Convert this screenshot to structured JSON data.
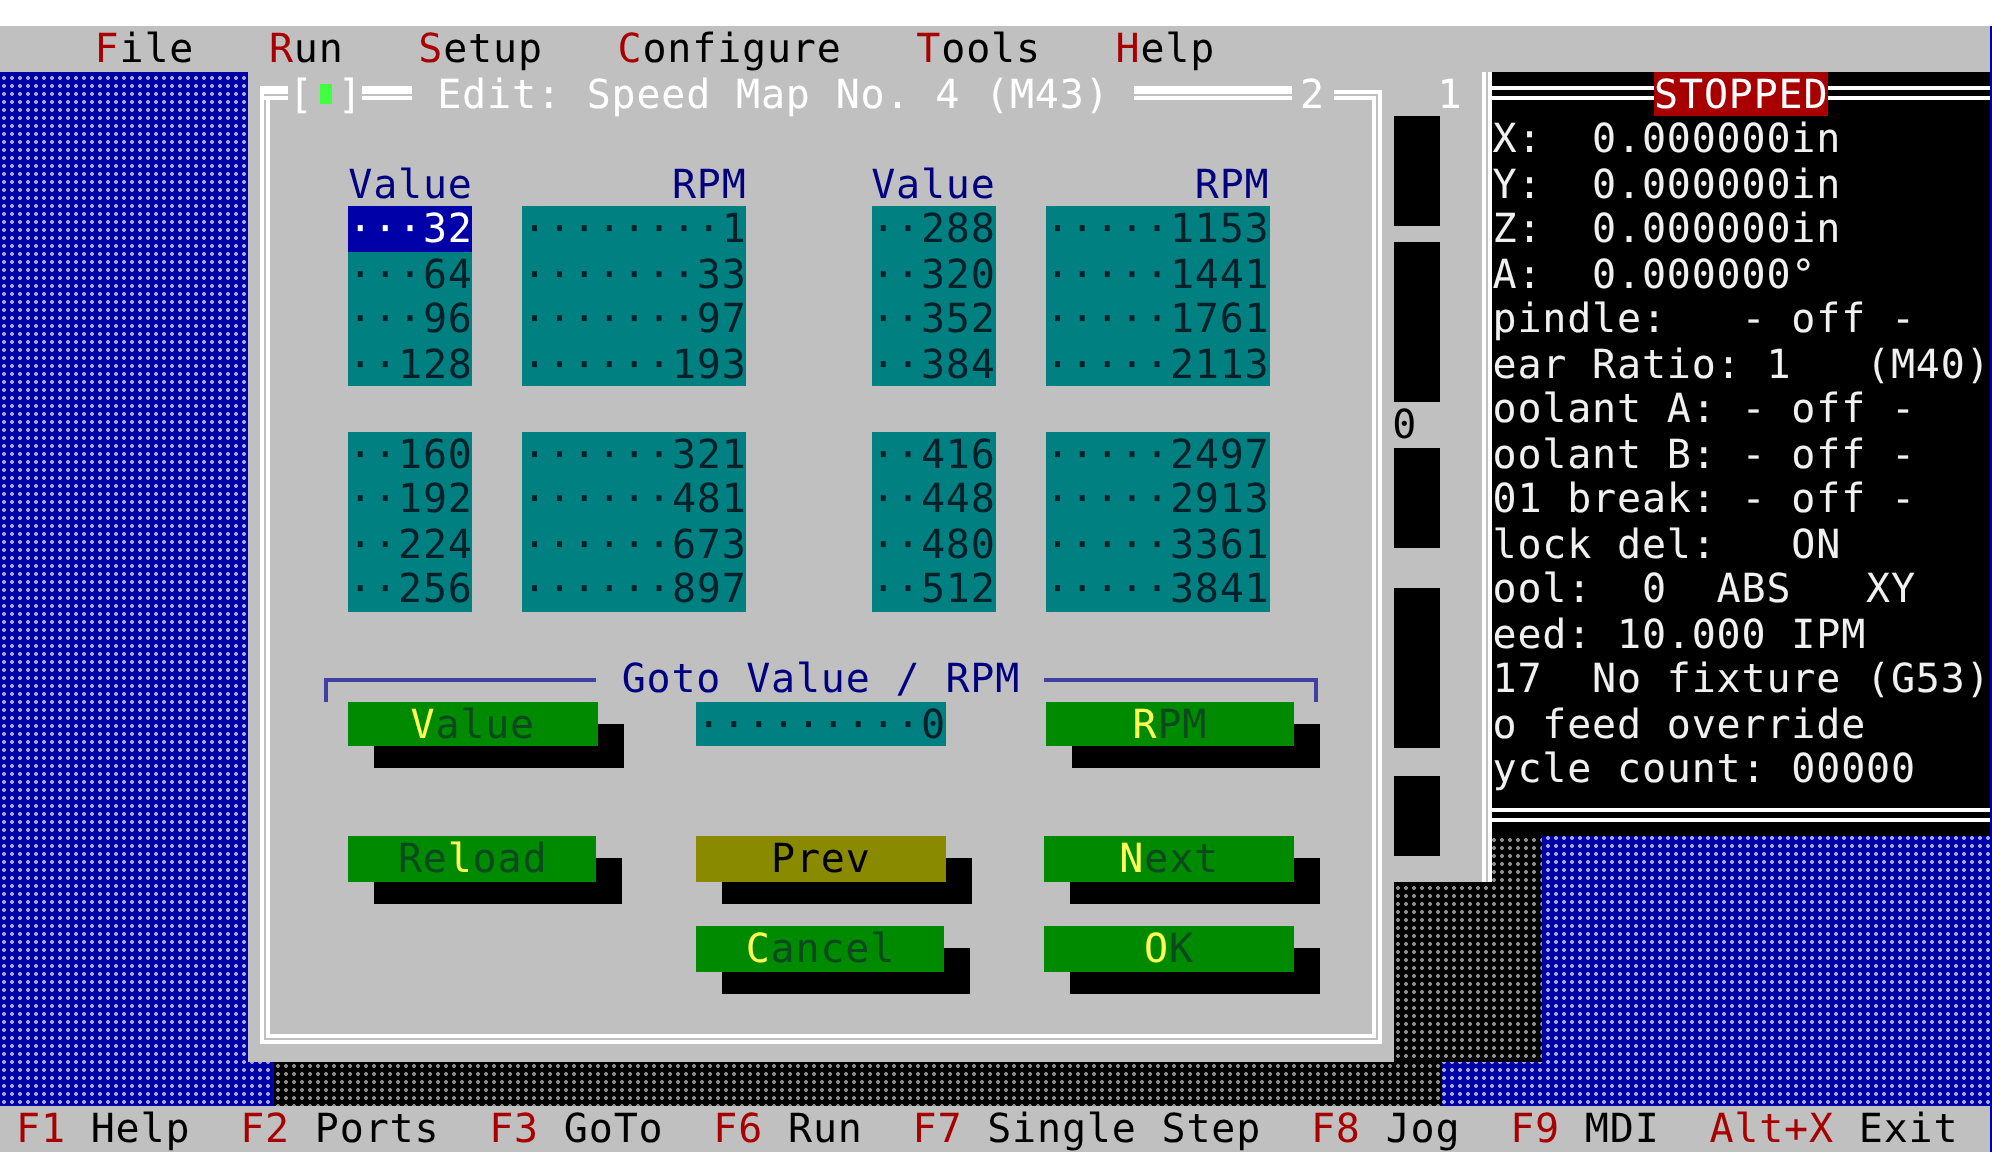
{
  "menu": [
    {
      "key": "F",
      "rest": "ile"
    },
    {
      "key": "R",
      "rest": "un"
    },
    {
      "key": "S",
      "rest": "etup"
    },
    {
      "key": "C",
      "rest": "onfigure"
    },
    {
      "key": "T",
      "rest": "ools"
    },
    {
      "key": "H",
      "rest": "elp"
    }
  ],
  "dialog": {
    "close_button": {
      "left": "[",
      "right": "]"
    },
    "title": "Edit: Speed Map No. 4 (M43)",
    "window_number": "2",
    "map": [
      {
        "value_header": "Value",
        "rpm_header": "RPM",
        "groups": [
          [
            {
              "value": "···32",
              "rpm": "········1",
              "selected": true
            },
            {
              "value": "···64",
              "rpm": "·······33",
              "selected": false
            },
            {
              "value": "···96",
              "rpm": "·······97",
              "selected": false
            },
            {
              "value": "··128",
              "rpm": "······193",
              "selected": false
            }
          ],
          [
            {
              "value": "··160",
              "rpm": "······321",
              "selected": false
            },
            {
              "value": "··192",
              "rpm": "······481",
              "selected": false
            },
            {
              "value": "··224",
              "rpm": "······673",
              "selected": false
            },
            {
              "value": "··256",
              "rpm": "······897",
              "selected": false
            }
          ]
        ]
      },
      {
        "value_header": "Value",
        "rpm_header": "RPM",
        "groups": [
          [
            {
              "value": "··288",
              "rpm": "·····1153",
              "selected": false
            },
            {
              "value": "··320",
              "rpm": "·····1441",
              "selected": false
            },
            {
              "value": "··352",
              "rpm": "·····1761",
              "selected": false
            },
            {
              "value": "··384",
              "rpm": "·····2113",
              "selected": false
            }
          ],
          [
            {
              "value": "··416",
              "rpm": "·····2497",
              "selected": false
            },
            {
              "value": "··448",
              "rpm": "·····2913",
              "selected": false
            },
            {
              "value": "··480",
              "rpm": "·····3361",
              "selected": false
            },
            {
              "value": "··512",
              "rpm": "·····3841",
              "selected": false
            }
          ]
        ]
      }
    ],
    "goto": {
      "title": "Goto Value / RPM",
      "field": "·········0",
      "buttons": [
        {
          "key": "V",
          "post": "alue",
          "focused": false
        },
        {
          "key": "R",
          "post": "PM",
          "focused": false
        }
      ]
    },
    "button_rows": [
      [
        {
          "pre": "Re",
          "key": "l",
          "post": "oad",
          "focused": false
        },
        {
          "pre": "Prev",
          "focused": true
        },
        {
          "key": "N",
          "post": "ext",
          "focused": false
        }
      ],
      [
        {
          "key": "C",
          "post": "ancel",
          "focused": false
        },
        {
          "key": "O",
          "post": "K",
          "focused": false
        }
      ]
    ]
  },
  "background_window": {
    "number": "1",
    "text": "0"
  },
  "status_panel": {
    "title": "STOPPED",
    "lines": [
      "X:  0.000000in",
      "Y:  0.000000in",
      "Z:  0.000000in",
      "A:  0.000000°",
      "pindle:   - off -",
      "ear Ratio: 1   (M40)",
      "oolant A: - off -",
      "oolant B: - off -",
      "01 break: - off -",
      "lock del:   ON",
      "ool:  0  ABS   XY",
      "eed: 10.000 IPM",
      "17  No fixture (G53)",
      "o feed override",
      "ycle count: 00000"
    ]
  },
  "status_bar": [
    {
      "key": "F1",
      "label": "Help"
    },
    {
      "key": "F2",
      "label": "Ports"
    },
    {
      "key": "F3",
      "label": "GoTo"
    },
    {
      "key": "F6",
      "label": "Run"
    },
    {
      "key": "F7",
      "label": "Single Step"
    },
    {
      "key": "F8",
      "label": "Jog"
    },
    {
      "key": "F9",
      "label": "MDI"
    },
    {
      "key": "Alt+X",
      "label": "Exit"
    }
  ]
}
